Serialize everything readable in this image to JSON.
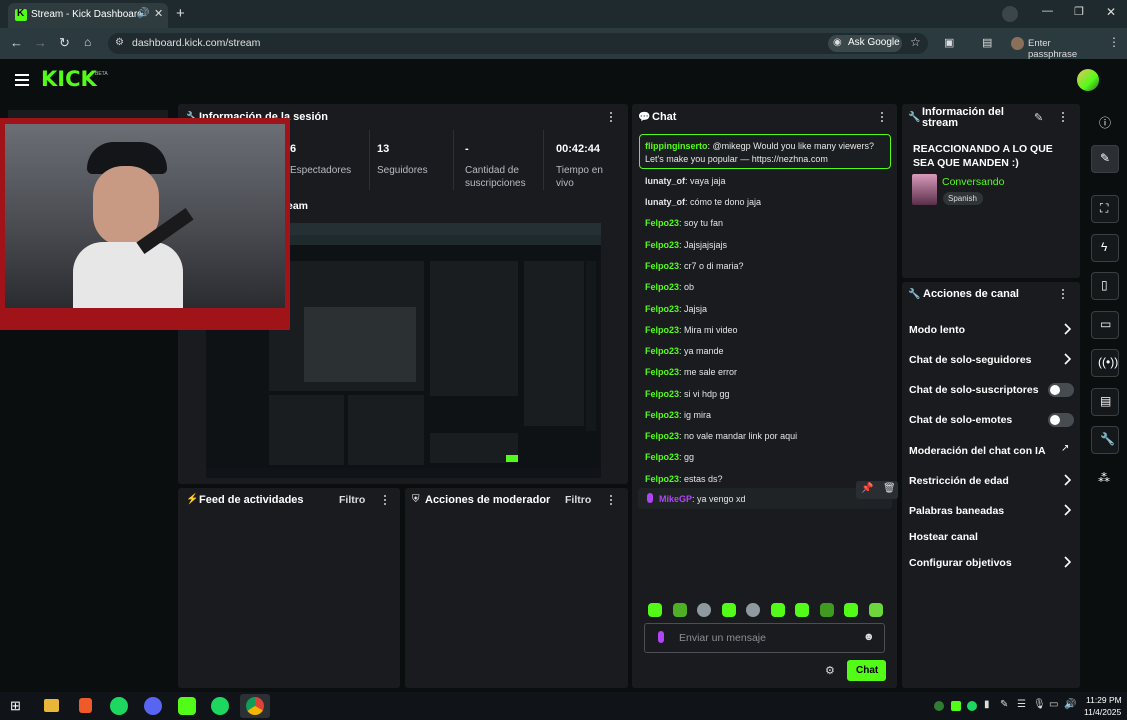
{
  "browser": {
    "tab_title": "Stream - Kick Dashboard",
    "url": "dashboard.kick.com/stream",
    "ask_google": "Ask Google",
    "profile": "Enter passphrase"
  },
  "header": {
    "logo": "KICK",
    "logo_badge": "BETA"
  },
  "session": {
    "title": "Información de la sesión",
    "stats": [
      {
        "value": "6",
        "label": "Espectadores"
      },
      {
        "value": "13",
        "label": "Seguidores"
      },
      {
        "value": "-",
        "label": "Cantidad de suscripciones"
      },
      {
        "value": "00:42:44",
        "label": "Tiempo en vivo"
      }
    ],
    "stream_label_partial": "eam"
  },
  "activity": {
    "title": "Feed de actividades",
    "filter": "Filtro"
  },
  "moderator": {
    "title": "Acciones de moderador",
    "filter": "Filtro"
  },
  "chat": {
    "title": "Chat",
    "pinned": {
      "user": "flippinginserto",
      "text": ": @mikegp Would you like many viewers? Let's make you popular — https://nezhna.com"
    },
    "messages": [
      {
        "user": "lunaty_of",
        "text": ": vaya jaja"
      },
      {
        "user": "lunaty_of",
        "text": ": cómo te dono jaja"
      },
      {
        "user": "Felpo23",
        "text": ": soy tu fan"
      },
      {
        "user": "Felpo23",
        "text": ": Jajsjajsjajs"
      },
      {
        "user": "Felpo23",
        "text": ": cr7 o di maria?"
      },
      {
        "user": "Felpo23",
        "text": ": ob"
      },
      {
        "user": "Felpo23",
        "text": ": Jajsja"
      },
      {
        "user": "Felpo23",
        "text": ": Mira mi video"
      },
      {
        "user": "Felpo23",
        "text": ": ya mande"
      },
      {
        "user": "Felpo23",
        "text": ": me sale error"
      },
      {
        "user": "Felpo23",
        "text": ": si vi hdp gg"
      },
      {
        "user": "Felpo23",
        "text": ": ig mira"
      },
      {
        "user": "Felpo23",
        "text": ": no vale mandar link por aqui"
      },
      {
        "user": "Felpo23",
        "text": ": gg"
      },
      {
        "user": "Felpo23",
        "text": ": estas ds?"
      },
      {
        "user": "MikeGP",
        "text": ": ya vengo xd"
      }
    ],
    "input_placeholder": "Enviar un mensaje",
    "send_label": "Chat"
  },
  "stream_info": {
    "title": "Información del stream",
    "stream_title": "REACCIONANDO A LO QUE SEA QUE MANDEN :)",
    "category": "Conversando",
    "language": "Spanish"
  },
  "channel_actions": {
    "title": "Acciones de canal",
    "items": [
      {
        "label": "Modo lento"
      },
      {
        "label": "Chat de solo-seguidores"
      },
      {
        "label": "Chat de solo-suscriptores"
      },
      {
        "label": "Chat de solo-emotes"
      },
      {
        "label": "Moderación del chat con IA"
      },
      {
        "label": "Restricción de edad"
      },
      {
        "label": "Palabras baneadas"
      },
      {
        "label": "Hostear canal"
      },
      {
        "label": "Configurar objetivos"
      }
    ]
  },
  "taskbar": {
    "time": "11:29 PM",
    "date": "11/4/2025"
  },
  "colors": {
    "accent": "#53fc18",
    "panel": "#191b1f",
    "background": "#0b0e0f"
  }
}
